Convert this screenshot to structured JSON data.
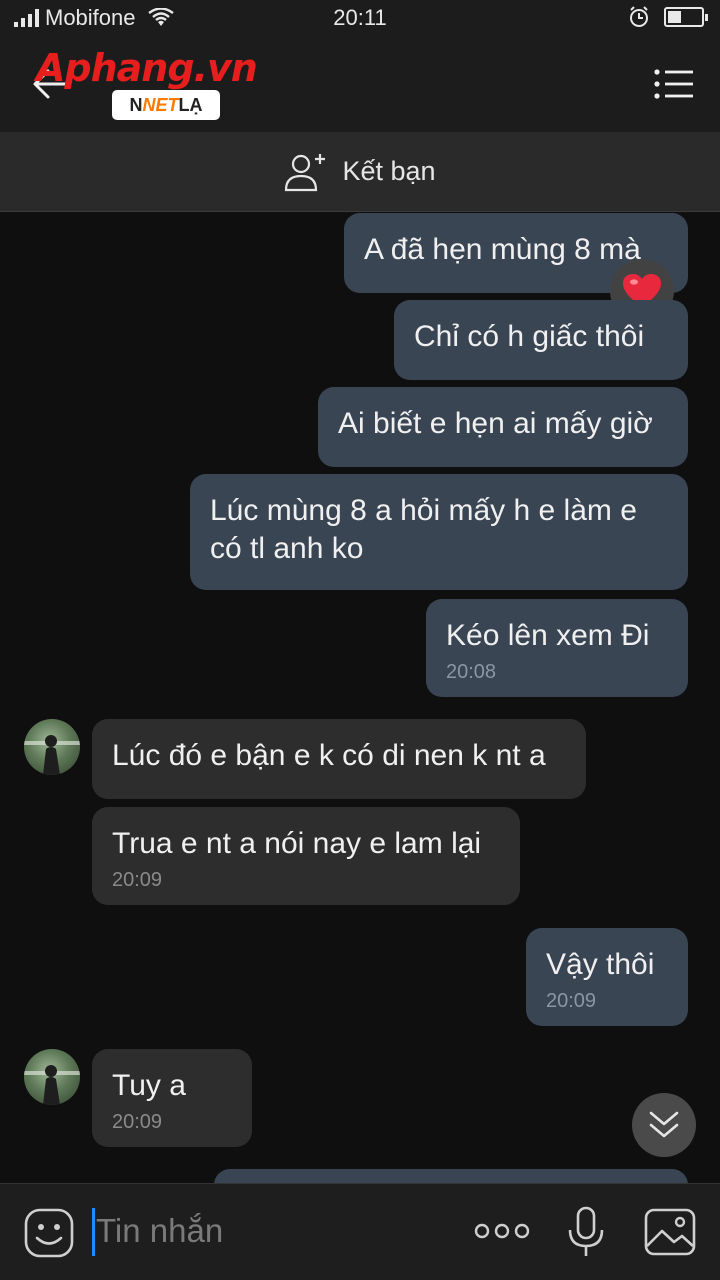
{
  "status_bar": {
    "carrier": "Mobifone",
    "time": "20:11",
    "battery_level": 0.35
  },
  "header": {
    "watermark_logo_text": "Aphang.vn",
    "watermark_badge_left": "N",
    "watermark_badge_net": "NET",
    "watermark_badge_right": "LẠ"
  },
  "add_friend": {
    "label": "Kết bạn"
  },
  "messages": [
    {
      "dir": "out",
      "text": "A đã hẹn mùng 8 mà",
      "reaction": "heart"
    },
    {
      "dir": "out",
      "text": "Chỉ có h giấc thôi"
    },
    {
      "dir": "out",
      "text": "Ai biết e hẹn ai mấy giờ"
    },
    {
      "dir": "out",
      "text": "Lúc mùng 8 a hỏi mấy h e làm e có tl anh ko"
    },
    {
      "dir": "out",
      "text": "Kéo lên xem Đi",
      "time": "20:08"
    },
    {
      "dir": "in",
      "text": "Lúc đó e bận e k có di nen k nt a"
    },
    {
      "dir": "in",
      "text": "Trua e nt a nói nay e lam lại",
      "time": "20:09"
    },
    {
      "dir": "out",
      "text": "Vậy thôi",
      "time": "20:09"
    },
    {
      "dir": "in",
      "text": "Tuy a",
      "time": "20:09"
    }
  ],
  "input": {
    "placeholder": "Tin nhắn"
  },
  "colors": {
    "outgoing_bubble": "#3a4554",
    "incoming_bubble": "#2d2d2d",
    "caret": "#1e8cff",
    "reaction_heart": "#e8283c"
  }
}
